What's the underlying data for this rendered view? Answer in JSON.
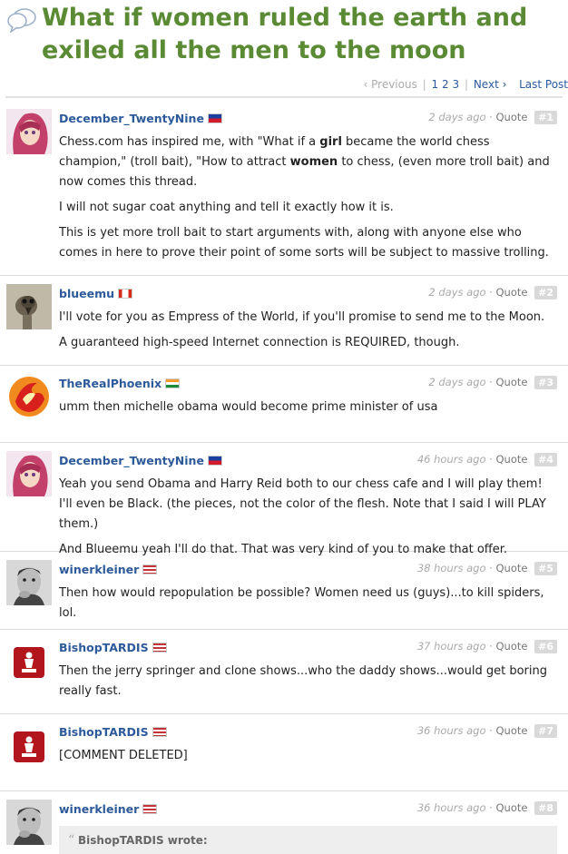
{
  "title": "What if women ruled the earth and exiled all the men to the moon",
  "pager": {
    "previous": "Previous",
    "pages": [
      "1",
      "2",
      "3"
    ],
    "next": "Next",
    "last": "Last Post"
  },
  "quote_label": "Quote",
  "posts": [
    {
      "user": "December_TwentyNine",
      "flag": "philippines-flag",
      "time": "2 days ago",
      "num": "#1",
      "paragraphs": [
        "Chess.com has inspired me, with \"What if a girl became the world chess champion,\" (troll bait), \"How to attract women to chess, (even more troll bait) and now comes this thread.",
        "I will not sugar coat anything and tell it exactly how it is.",
        "This is yet more troll bait to start arguments with, along with anyone else who comes in here to prove their point of some sorts will be subject to massive trolling."
      ]
    },
    {
      "user": "blueemu",
      "flag": "canada-flag",
      "time": "2 days ago",
      "num": "#2",
      "paragraphs": [
        "I'll vote for you as Empress of the World, if you'll promise to send me to the Moon.",
        "A guaranteed high-speed Internet connection is REQUIRED, though."
      ]
    },
    {
      "user": "TheRealPhoenix",
      "flag": "india-flag",
      "time": "2 days ago",
      "num": "#3",
      "paragraphs": [
        "umm then michelle obama would become prime minister of usa"
      ]
    },
    {
      "user": "December_TwentyNine",
      "flag": "philippines-flag",
      "time": "46 hours ago",
      "num": "#4",
      "paragraphs": [
        "Yeah you send Obama and Harry Reid both to our chess cafe and I will play them! I'll even be Black. (the pieces, not the color of the flesh. Note that I said I will PLAY them.)",
        "And Blueemu yeah I'll do that. That was very kind of you to make that offer."
      ]
    },
    {
      "user": "winerkleiner",
      "flag": "usa-flag",
      "time": "38 hours ago",
      "num": "#5",
      "paragraphs": [
        "Then how would repopulation be possible?  Women need us (guys)...to kill spiders, lol."
      ]
    },
    {
      "user": "BishopTARDIS",
      "flag": "usa-flag",
      "time": "37 hours ago",
      "num": "#6",
      "paragraphs": [
        "Then the jerry springer and clone shows...who the daddy shows...would get boring really fast."
      ]
    },
    {
      "user": "BishopTARDIS",
      "flag": "usa-flag",
      "time": "36 hours ago",
      "num": "#7",
      "paragraphs": [
        "[COMMENT DELETED]"
      ]
    },
    {
      "user": "winerkleiner",
      "flag": "usa-flag",
      "time": "36 hours ago",
      "num": "#8",
      "paragraphs": [],
      "quote": "BishopTARDIS wrote:"
    }
  ]
}
